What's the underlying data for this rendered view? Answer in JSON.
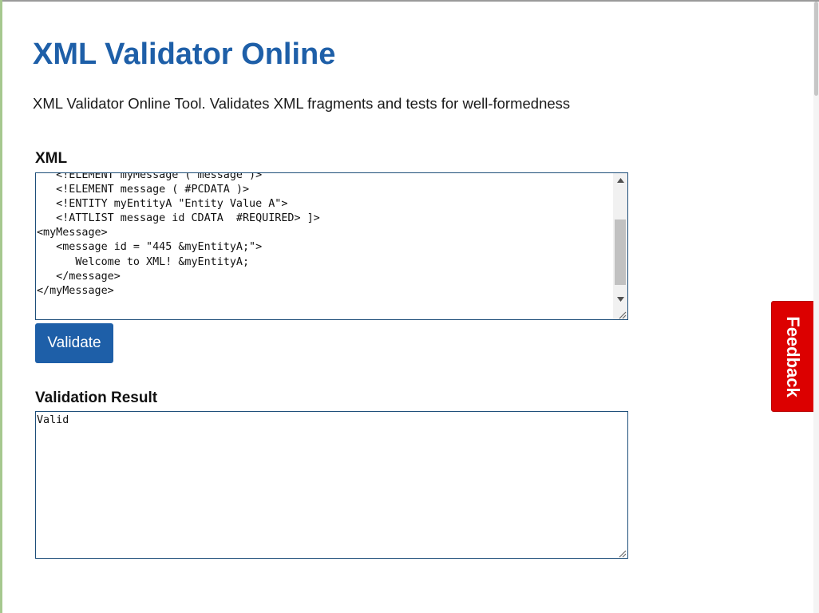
{
  "header": {
    "title": "XML Validator Online",
    "description": "XML Validator Online Tool. Validates XML fragments and tests for well-formedness"
  },
  "xml_section": {
    "label": "XML",
    "value_lines": "   <!ELEMENT myMessage ( message )>\n   <!ELEMENT message ( #PCDATA )>\n   <!ENTITY myEntityA \"Entity Value A\">\n   <!ATTLIST message id CDATA  #REQUIRED> ]>\n<myMessage>\n   <message id = \"445 &myEntityA;\">\n      Welcome to XML! &myEntityA;\n   </message>\n</myMessage>"
  },
  "actions": {
    "validate_label": "Validate"
  },
  "result_section": {
    "label": "Validation Result",
    "value": "Valid"
  },
  "feedback": {
    "label": "Feedback"
  },
  "colors": {
    "accent": "#1e5fa8",
    "feedback": "#dc0000",
    "left_bar": "#a6c88f"
  },
  "icons": {
    "scroll_up": "chevron-up-icon",
    "scroll_down": "chevron-down-icon",
    "resize": "resize-grip-icon"
  }
}
